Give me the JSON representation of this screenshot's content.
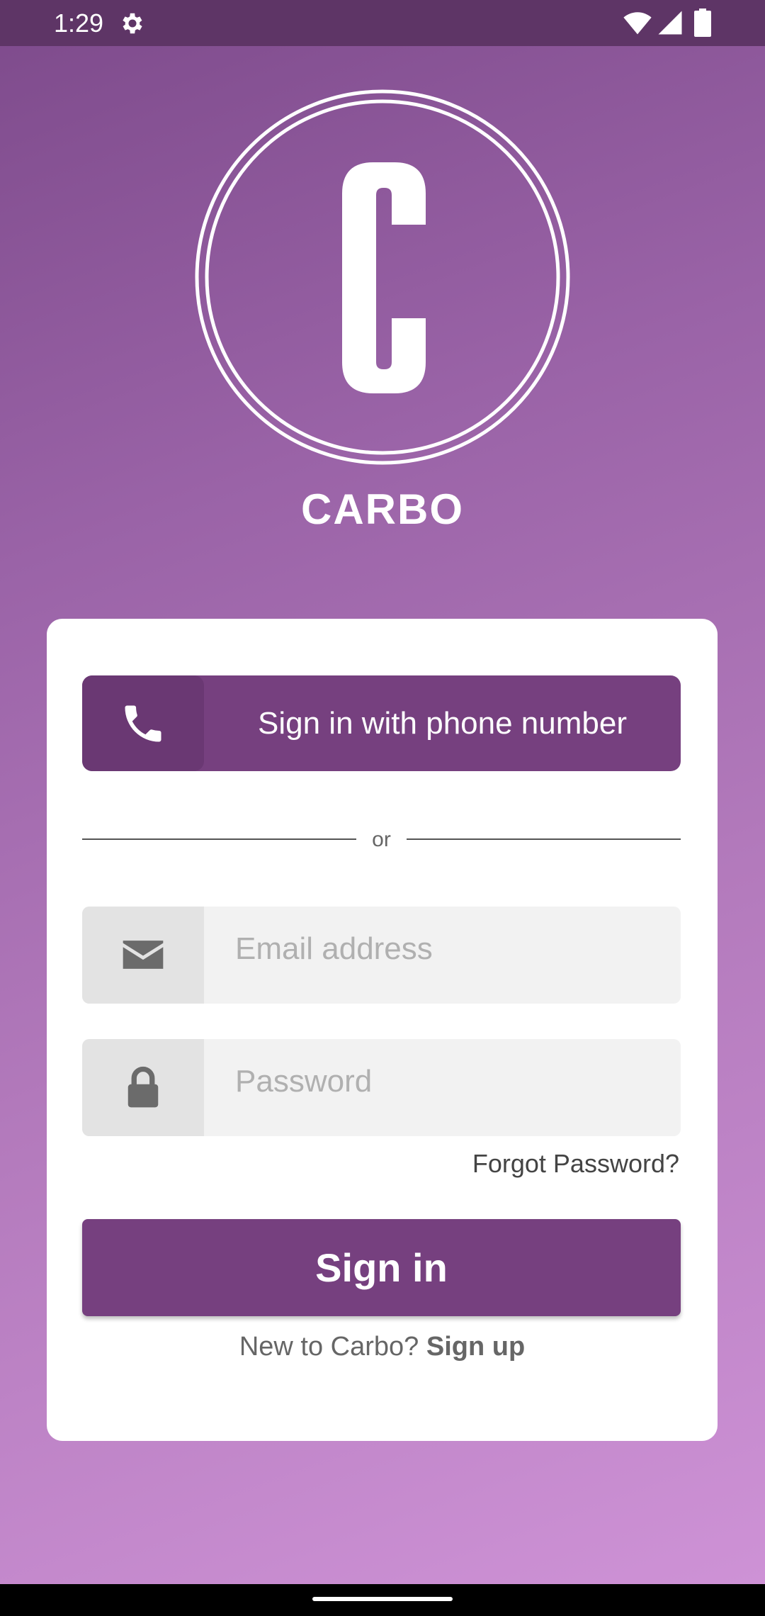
{
  "status_bar": {
    "time": "1:29",
    "icons": [
      "gear-icon",
      "wifi-icon",
      "signal-icon",
      "battery-icon"
    ]
  },
  "logo": {
    "letter": "C",
    "brand_name": "CARBO"
  },
  "card": {
    "phone_button": {
      "label": "Sign in with phone number",
      "icon": "phone-icon"
    },
    "divider_text": "or",
    "email": {
      "placeholder": "Email address",
      "value": "",
      "icon": "envelope-icon"
    },
    "password": {
      "placeholder": "Password",
      "value": "",
      "icon": "lock-icon"
    },
    "forgot_password": "Forgot Password?",
    "signin_button": "Sign in",
    "signup_prompt": "New to Carbo?",
    "signup_link": "Sign up"
  },
  "colors": {
    "accent": "#76407f",
    "status_bar": "#5e3566",
    "gradient_top": "#7d4a8b",
    "gradient_bottom": "#cf93d7"
  }
}
